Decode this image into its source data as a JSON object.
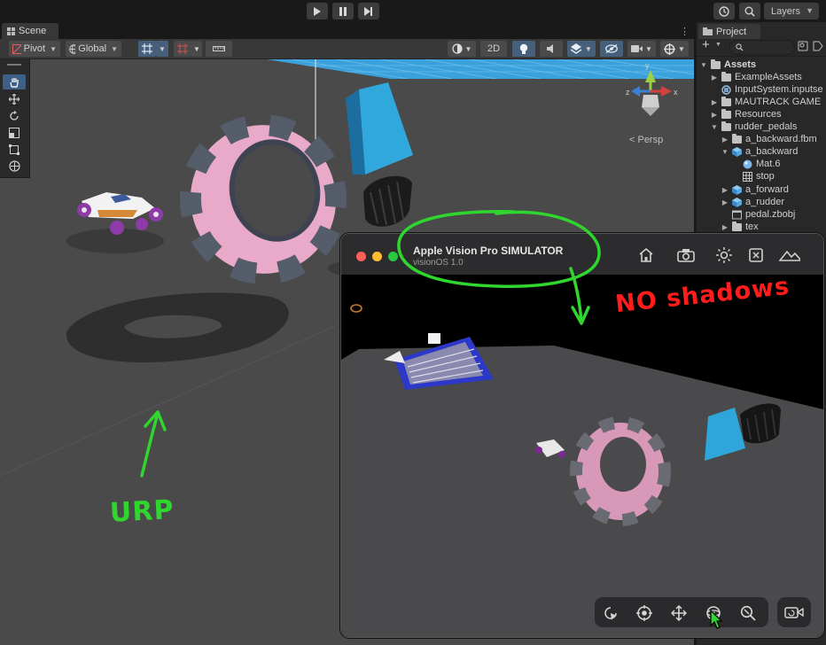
{
  "toolbar": {
    "play_icon": "play-icon",
    "pause_icon": "pause-icon",
    "step_icon": "step-icon",
    "history_icon": "history-icon",
    "search_icon": "search-icon",
    "layers_label": "Layers"
  },
  "scene": {
    "tab_label": "Scene",
    "pivot_label": "Pivot",
    "global_label": "Global",
    "mode_2d_label": "2D",
    "persp_label": "< Persp"
  },
  "project": {
    "tab_label": "Project",
    "add_label": "+",
    "assets_label": "Assets",
    "items": [
      {
        "label": "ExampleAssets",
        "icon": "folder-icon"
      },
      {
        "label": "InputSystem.inputse",
        "icon": "input-asset-icon"
      },
      {
        "label": "MAUTRACK GAME",
        "icon": "folder-icon"
      },
      {
        "label": "Resources",
        "icon": "folder-icon"
      },
      {
        "label": "rudder_pedals",
        "icon": "folder-icon"
      },
      {
        "label": "a_backward.fbm",
        "icon": "folder-icon"
      },
      {
        "label": "a_backward",
        "icon": "prefab-icon"
      },
      {
        "label": "Mat.6",
        "icon": "material-icon"
      },
      {
        "label": "stop",
        "icon": "texture-icon"
      },
      {
        "label": "a_forward",
        "icon": "prefab-icon"
      },
      {
        "label": "a_rudder",
        "icon": "prefab-icon"
      },
      {
        "label": "pedal.zbobj",
        "icon": "file-icon"
      },
      {
        "label": "tex",
        "icon": "folder-icon"
      }
    ]
  },
  "simulator": {
    "title": "Apple Vision Pro SIMULATOR",
    "subtitle": "visionOS 1.0",
    "title_icons": [
      "home-icon",
      "camera-icon",
      "brightness-icon",
      "window-icon",
      "landscape-icon"
    ],
    "controls": [
      "select-icon",
      "look-icon",
      "move-icon",
      "orbit-icon",
      "zoom-icon"
    ],
    "record_icon": "camera-rotate-icon"
  },
  "annotations": {
    "urp": "URP",
    "no_shadows": "NO shadows"
  },
  "colors": {
    "annotation_green": "#2ed62e",
    "annotation_red": "#ff1c1c",
    "selection_blue": "#46607c"
  }
}
